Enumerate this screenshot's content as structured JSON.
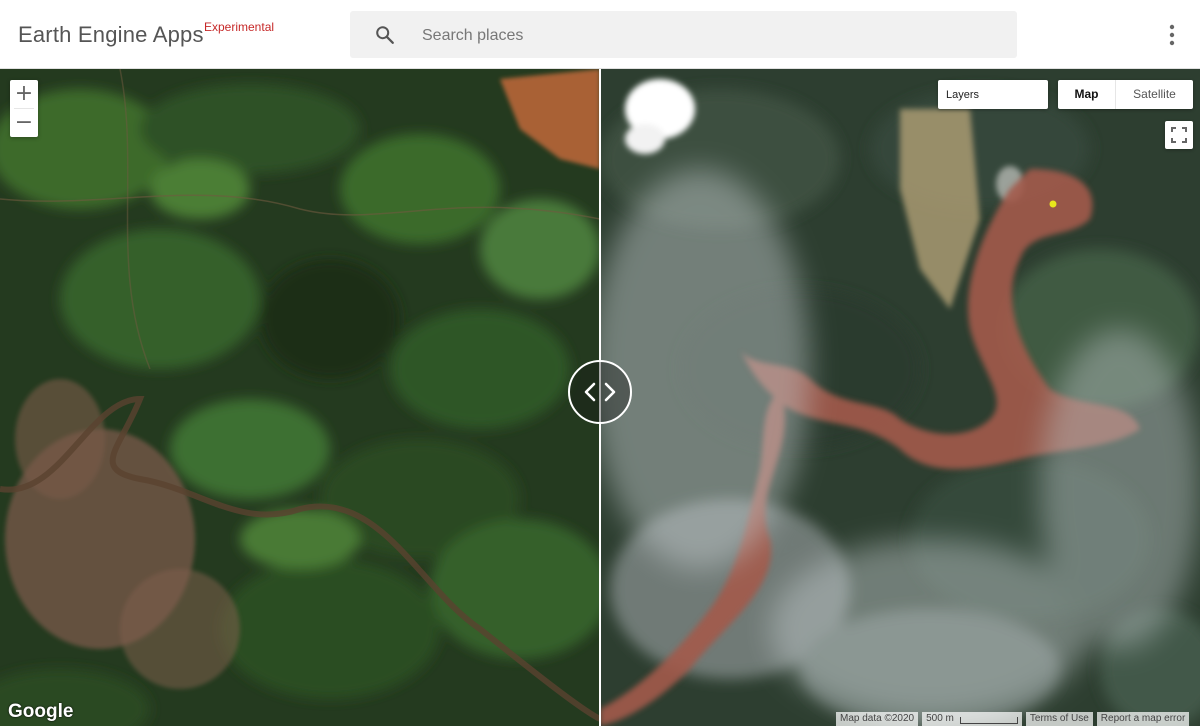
{
  "header": {
    "app_title": "Earth Engine Apps",
    "badge": "Experimental",
    "badge_color": "#c62828",
    "search_placeholder": "Search places",
    "search_value": "",
    "search_icon": "search-icon",
    "menu_icon": "more-vert-icon"
  },
  "map": {
    "zoom_in": "+",
    "zoom_out": "−",
    "layers_label": "Layers",
    "map_type": {
      "map": "Map",
      "satellite": "Satellite",
      "selected": "Map"
    },
    "fullscreen_icon": "fullscreen-icon",
    "splitter_icon": "split-handle-icon",
    "logo_text": "Google",
    "attribution": {
      "map_data": "Map data ©2020",
      "scale": "500 m",
      "terms": "Terms of Use",
      "report": "Report a map error"
    }
  }
}
